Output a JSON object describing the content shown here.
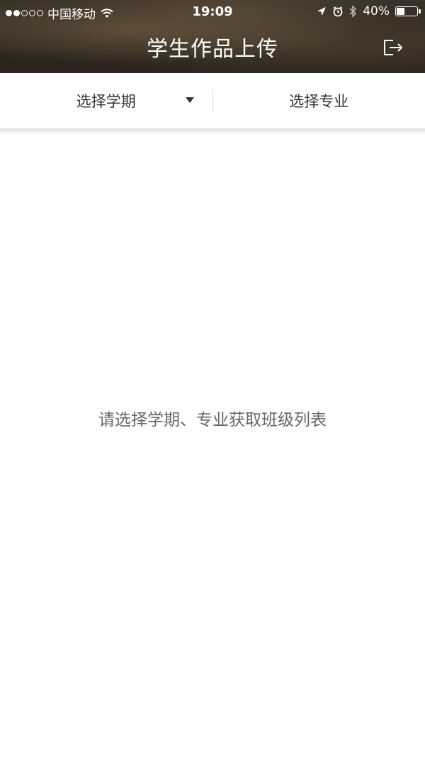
{
  "status_bar": {
    "carrier": "中国移动",
    "time": "19:09",
    "battery_percent": "40%",
    "battery_level": 0.4,
    "signal_bars_filled": 2,
    "signal_bars_total": 5
  },
  "header": {
    "title": "学生作品上传",
    "logout_icon": "logout-icon"
  },
  "filters": {
    "semester_label": "选择学期",
    "major_label": "选择专业"
  },
  "main": {
    "empty_message": "请选择学期、专业获取班级列表"
  },
  "colors": {
    "header_bg": "#2e271f",
    "text_primary": "#333333",
    "text_secondary": "#666666",
    "background": "#ffffff"
  }
}
